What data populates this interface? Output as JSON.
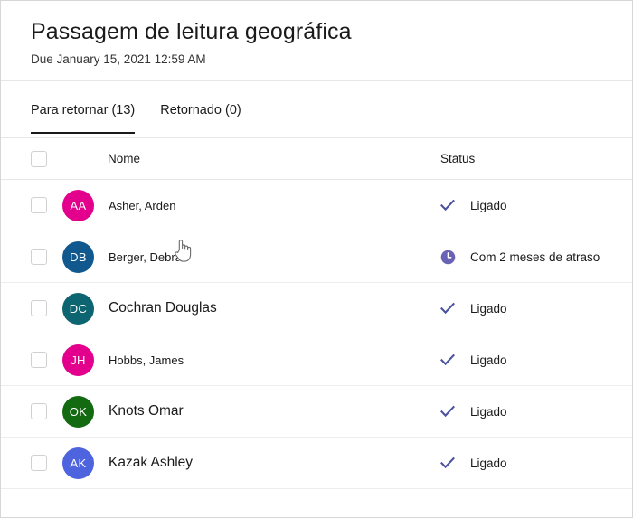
{
  "header": {
    "title": "Passagem de leitura geográfica",
    "due": "Due January 15, 2021 12:59 AM"
  },
  "tabs": [
    {
      "label": "Para retornar (13)",
      "active": true
    },
    {
      "label": "Retornado (0)",
      "active": false
    }
  ],
  "table": {
    "columns": {
      "name": "Nome",
      "status": "Status"
    },
    "rows": [
      {
        "initials": "AA",
        "name": "Asher, Arden",
        "avatar_color": "#E3008C",
        "status": "Ligado",
        "status_icon": "check-icon",
        "name_size": "sm"
      },
      {
        "initials": "DB",
        "name": "Berger, Debra",
        "avatar_color": "#11588F",
        "status": "Com 2 meses de atraso",
        "status_icon": "clock-icon",
        "name_size": "sm"
      },
      {
        "initials": "DC",
        "name": "Cochran Douglas",
        "avatar_color": "#0E6572",
        "status": "Ligado",
        "status_icon": "check-icon",
        "name_size": "lg"
      },
      {
        "initials": "JH",
        "name": "Hobbs, James",
        "avatar_color": "#E3008C",
        "status": "Ligado",
        "status_icon": "check-icon",
        "name_size": "sm"
      },
      {
        "initials": "OK",
        "name": "Knots Omar",
        "avatar_color": "#136A10",
        "status": "Ligado",
        "status_icon": "check-icon",
        "name_size": "lg"
      },
      {
        "initials": "AK",
        "name": "Kazak Ashley",
        "avatar_color": "#4E63DE",
        "status": "Ligado",
        "status_icon": "check-icon",
        "name_size": "lg"
      }
    ]
  },
  "colors": {
    "check_icon": "#4B52A0",
    "clock_icon": "#6A63B5",
    "tab_underline": "#1a1a1a",
    "border": "#e6e6e6"
  },
  "cursor": {
    "type": "pointing-hand-cursor"
  }
}
